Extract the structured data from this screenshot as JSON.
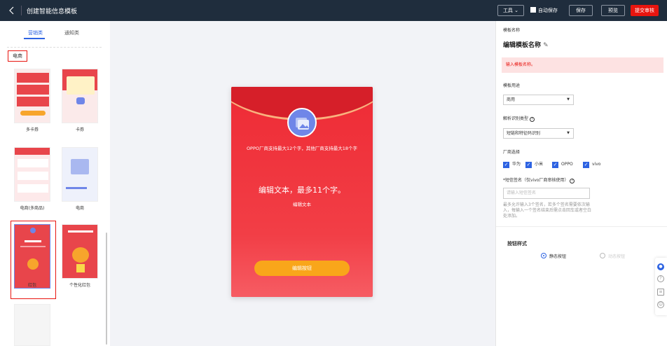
{
  "header": {
    "back_icon": "chevron-left-icon",
    "title": "创建智能信息模板",
    "tools_label": "工具",
    "autosave_label": "自动保存",
    "save_label": "保存",
    "preview_label": "预览",
    "submit_label": "提交审核"
  },
  "left": {
    "tabs": [
      {
        "label": "营销类",
        "active": true
      },
      {
        "label": "通知类",
        "active": false
      }
    ],
    "category": "电商",
    "templates": [
      {
        "label": "多卡券"
      },
      {
        "label": "卡券"
      },
      {
        "label": "电商(多商品)"
      },
      {
        "label": "电商"
      },
      {
        "label": "红包",
        "selected": true
      },
      {
        "label": "个性化红包"
      }
    ]
  },
  "preview": {
    "image_icon": "image-icon",
    "notice": "OPPO厂商支持最大12个字，其他厂商支持最大18个字",
    "heading": "编辑文本，最多11个字。",
    "subtext": "编辑文本",
    "button": "编辑按钮"
  },
  "settings": {
    "name_label": "模板名称",
    "name_value": "编辑模板名称",
    "edit_icon": "pencil-icon",
    "error": "输入模板名称。",
    "usage_label": "模板用途",
    "usage_value": "商用",
    "parse_label": "解析识别类型",
    "parse_value": "短链和特征码识别",
    "vendor_label": "厂商选择",
    "vendors": [
      "华为",
      "小米",
      "OPPO",
      "vivo"
    ],
    "sign_label": "*短信签名（仅vivo厂商审核使用）",
    "sign_placeholder": "请输入短信签名",
    "sign_hint": "最多允许输入3个签名，若多个签名需要依次输入，每输入一个签名结束后需点击回车或者空白处添加。",
    "button_style_label": "按钮样式",
    "radio_static": "静态按钮",
    "radio_dynamic": "动态按钮"
  },
  "colors": {
    "accent": "#2d63e2",
    "brand_red": "#e8150f",
    "envelope_red": "#ee2b35",
    "button_orange": "#f9a61a"
  }
}
